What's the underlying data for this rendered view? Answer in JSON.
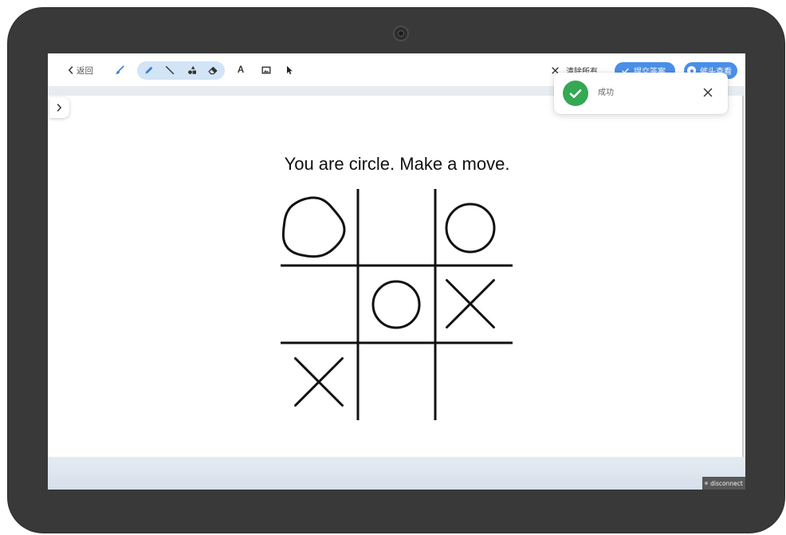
{
  "toolbar": {
    "back": {
      "icon": "chevron-left-icon",
      "label": "返回"
    },
    "tools": {
      "brush": "brush-icon",
      "pencil": "pencil-icon",
      "line": "line-icon",
      "shapes": "shapes-icon",
      "eraser": "eraser-icon",
      "text_glyph": "A",
      "image": "image-icon",
      "cursor": "cursor-icon"
    },
    "clear": {
      "icon": "close-icon",
      "label": "清除所有"
    },
    "submit": {
      "icon": "check-icon",
      "label": "提交答案"
    },
    "third": {
      "icon": "circle-dot-icon",
      "label": "催头查看"
    }
  },
  "toast": {
    "icon": "check-circle-icon",
    "message": "成功",
    "close_icon": "close-icon"
  },
  "side_panel": {
    "toggle_icon": "chevron-right-icon"
  },
  "canvas": {
    "prompt": "You are circle. Make a move.",
    "board": {
      "cells": [
        "O",
        "",
        "O",
        "",
        "O",
        "X",
        "X",
        "",
        ""
      ]
    }
  },
  "status": {
    "label": "disconnect"
  },
  "colors": {
    "accent": "#4a8fe7",
    "success": "#34a853",
    "bezel": "#393939",
    "ink": "#111111"
  }
}
